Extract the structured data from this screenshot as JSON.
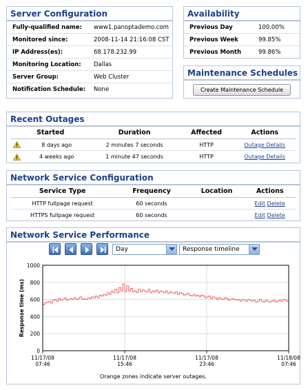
{
  "server_config": {
    "title": "Server Configuration",
    "rows": [
      {
        "key": "Fully-qualified name:",
        "value": "www1.panoptademo.com"
      },
      {
        "key": "Monitored since:",
        "value": "2008-11-14 21:16:08 CST"
      },
      {
        "key": "IP Address(es):",
        "value": "68.178.232.99"
      },
      {
        "key": "Monitoring Location:",
        "value": "Dallas"
      },
      {
        "key": "Server Group:",
        "value": "Web Cluster"
      },
      {
        "key": "Notification Schedule:",
        "value": "None"
      }
    ]
  },
  "availability": {
    "title": "Availability",
    "rows": [
      {
        "key": "Previous Day",
        "value": "100.00%"
      },
      {
        "key": "Previous Week",
        "value": "99.85%"
      },
      {
        "key": "Previous Month",
        "value": "99.86%"
      }
    ]
  },
  "maintenance": {
    "title": "Maintenance Schedules",
    "button_label": "Create Maintenance Schedule"
  },
  "outages": {
    "title": "Recent Outages",
    "headers": {
      "started": "Started",
      "duration": "Duration",
      "affected": "Affected",
      "actions": "Actions"
    },
    "rows": [
      {
        "started": "8 days ago",
        "duration": "2 minutes 7 seconds",
        "affected": "HTTP",
        "action": "Outage Details",
        "icon": "warning-icon"
      },
      {
        "started": "4 weeks ago",
        "duration": "1 minute 47 seconds",
        "affected": "HTTP",
        "action": "Outage Details",
        "icon": "warning-icon"
      }
    ]
  },
  "services": {
    "title": "Network Service Configuration",
    "headers": {
      "type": "Service Type",
      "frequency": "Frequency",
      "location": "Location",
      "actions": "Actions"
    },
    "rows": [
      {
        "type": "HTTP fullpage request",
        "frequency": "60 seconds",
        "location": "",
        "edit": "Edit",
        "delete": "Delete"
      },
      {
        "type": "HTTPS fullpage request",
        "frequency": "60 seconds",
        "location": "",
        "edit": "Edit",
        "delete": "Delete"
      }
    ]
  },
  "performance": {
    "title": "Network Service Performance",
    "period_select": "Day",
    "metric_select": "Response timeline",
    "footnote": "Orange zones indicate server outages.",
    "nav_icons": [
      "first-page-icon",
      "previous-page-icon",
      "next-page-icon",
      "last-page-icon"
    ]
  },
  "chart_data": {
    "type": "line",
    "title": "",
    "xlabel": "",
    "ylabel": "Response time (ms)",
    "ylim": [
      0,
      1000
    ],
    "yticks": [
      "0",
      "200",
      "400",
      "600",
      "800",
      "1000"
    ],
    "xtick_labels": [
      [
        "11/17/08",
        "07:46"
      ],
      [
        "11/17/08",
        "15:46"
      ],
      [
        "11/17/08",
        "23:46"
      ],
      [
        "11/18/08",
        "07:46"
      ]
    ],
    "grid": true,
    "colors": {
      "line": "#f06262",
      "grid": "#c8c8c8"
    },
    "series": [
      {
        "values": [
          540,
          560,
          570,
          580,
          560,
          590,
          600,
          580,
          610,
          590,
          600,
          620,
          590,
          600,
          610,
          600,
          620,
          600,
          610,
          630,
          600,
          610,
          600,
          620,
          610,
          630,
          620,
          640,
          620,
          650,
          640,
          660,
          650,
          680,
          660,
          700,
          680,
          720,
          680,
          740,
          700,
          780,
          690,
          760,
          700,
          730,
          690,
          700,
          680,
          720,
          690,
          710,
          700,
          690,
          720,
          680,
          700,
          690,
          710,
          680,
          700,
          690,
          680,
          700,
          670,
          690,
          680,
          670,
          690,
          660,
          680,
          670,
          650,
          660,
          670,
          650,
          640,
          660,
          640,
          650,
          630,
          650,
          640,
          620,
          630,
          640,
          610,
          630,
          620,
          600,
          620,
          610,
          600,
          620,
          610,
          590,
          600,
          610,
          600,
          590,
          600,
          580,
          600,
          590,
          580,
          600,
          590,
          580,
          590,
          570,
          580,
          600,
          580,
          570,
          590,
          580,
          570,
          580,
          590,
          570,
          580,
          590,
          580,
          600,
          590,
          580,
          600
        ]
      }
    ]
  }
}
